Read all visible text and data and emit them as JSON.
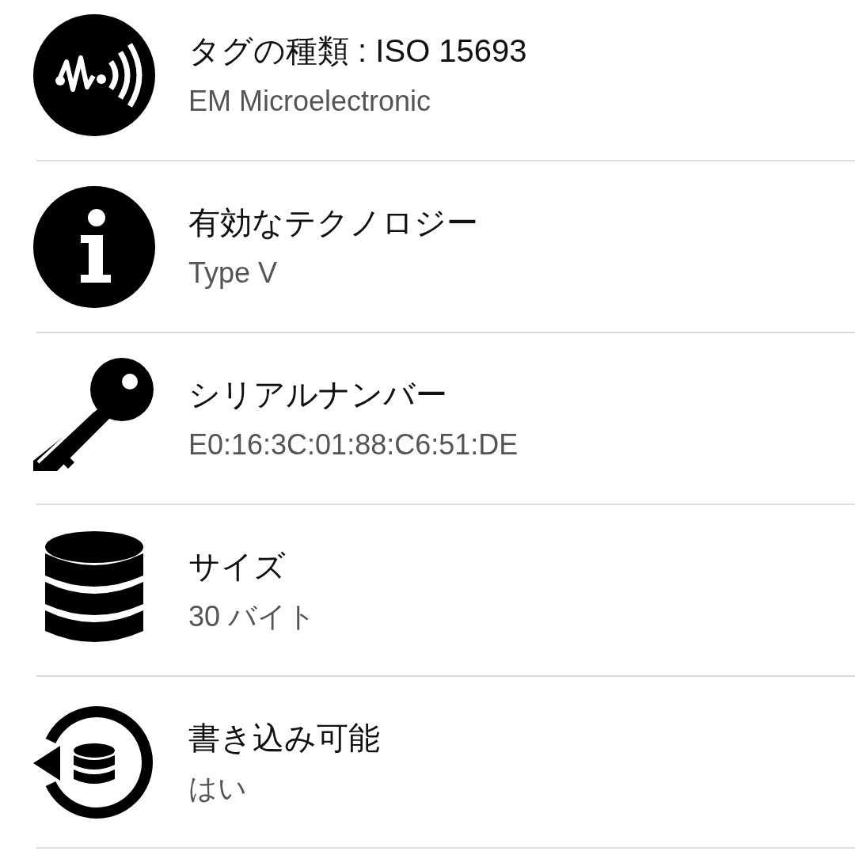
{
  "rows": [
    {
      "kind": "nfc",
      "title": "タグの種類 : ISO 15693",
      "value": "EM Microelectronic"
    },
    {
      "kind": "info",
      "title": "有効なテクノロジー",
      "value": "Type V"
    },
    {
      "kind": "key",
      "title": "シリアルナンバー",
      "value": "E0:16:3C:01:88:C6:51:DE"
    },
    {
      "kind": "database",
      "title": "サイズ",
      "value": "30 バイト"
    },
    {
      "kind": "rewrite",
      "title": "書き込み可能",
      "value": "はい"
    }
  ]
}
